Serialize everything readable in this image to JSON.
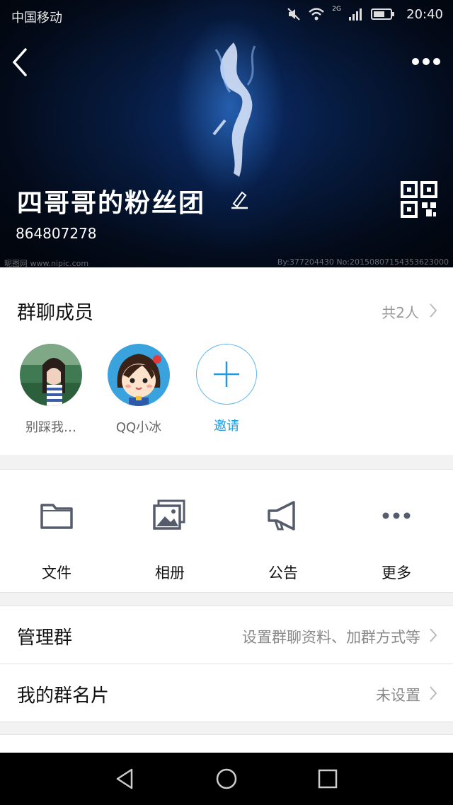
{
  "status_bar": {
    "carrier": "中国移动",
    "time": "20:40",
    "signal_type": "2G"
  },
  "header": {
    "group_name": "四哥哥的粉丝团",
    "group_id": "864807278",
    "watermark_left": "昵图网 www.nipic.com",
    "watermark_right": "By:377204430 No:20150807154353623000"
  },
  "members": {
    "title": "群聊成员",
    "count_label": "共2人",
    "list": [
      {
        "name": "别踩我…"
      },
      {
        "name": "QQ小冰"
      }
    ],
    "invite_label": "邀请"
  },
  "tools": [
    {
      "label": "文件",
      "icon": "folder-icon"
    },
    {
      "label": "相册",
      "icon": "album-icon"
    },
    {
      "label": "公告",
      "icon": "megaphone-icon"
    },
    {
      "label": "更多",
      "icon": "more-dots-icon"
    }
  ],
  "settings": [
    {
      "title": "管理群",
      "value": "设置群聊资料、加群方式等"
    },
    {
      "title": "我的群名片",
      "value": "未设置"
    }
  ],
  "colors": {
    "accent": "#1e9be0",
    "hero_dark": "#030a18",
    "hero_glow": "#3c8cf0"
  }
}
